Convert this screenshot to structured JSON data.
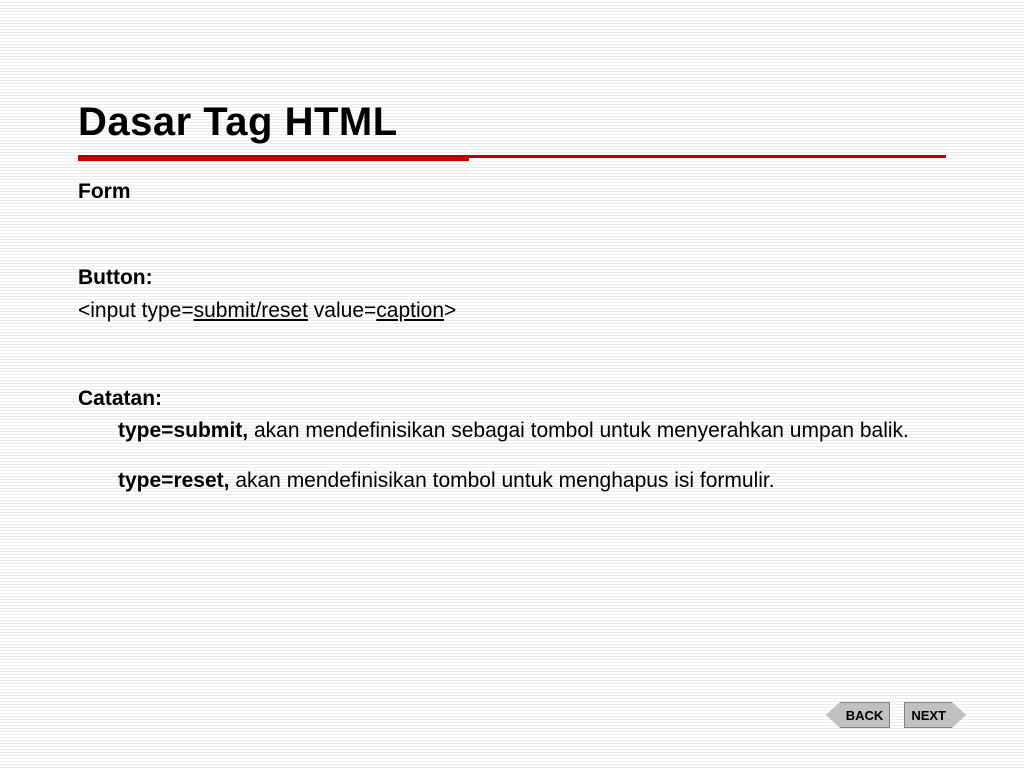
{
  "title": "Dasar Tag HTML",
  "section_form": "Form",
  "section_button": "Button:",
  "code": {
    "prefix": "<input type=",
    "type_val": "submit/reset",
    "mid": " value=",
    "value_val": "caption",
    "suffix": ">"
  },
  "section_notes": "Catatan:",
  "note1": {
    "lead": "type=submit,",
    "body": " akan mendefinisikan sebagai tombol untuk menyerahkan umpan balik."
  },
  "note2": {
    "lead": "type=reset,",
    "body": " akan mendefinisikan tombol untuk menghapus isi formulir."
  },
  "nav": {
    "back": "BACK",
    "next": "NEXT"
  }
}
